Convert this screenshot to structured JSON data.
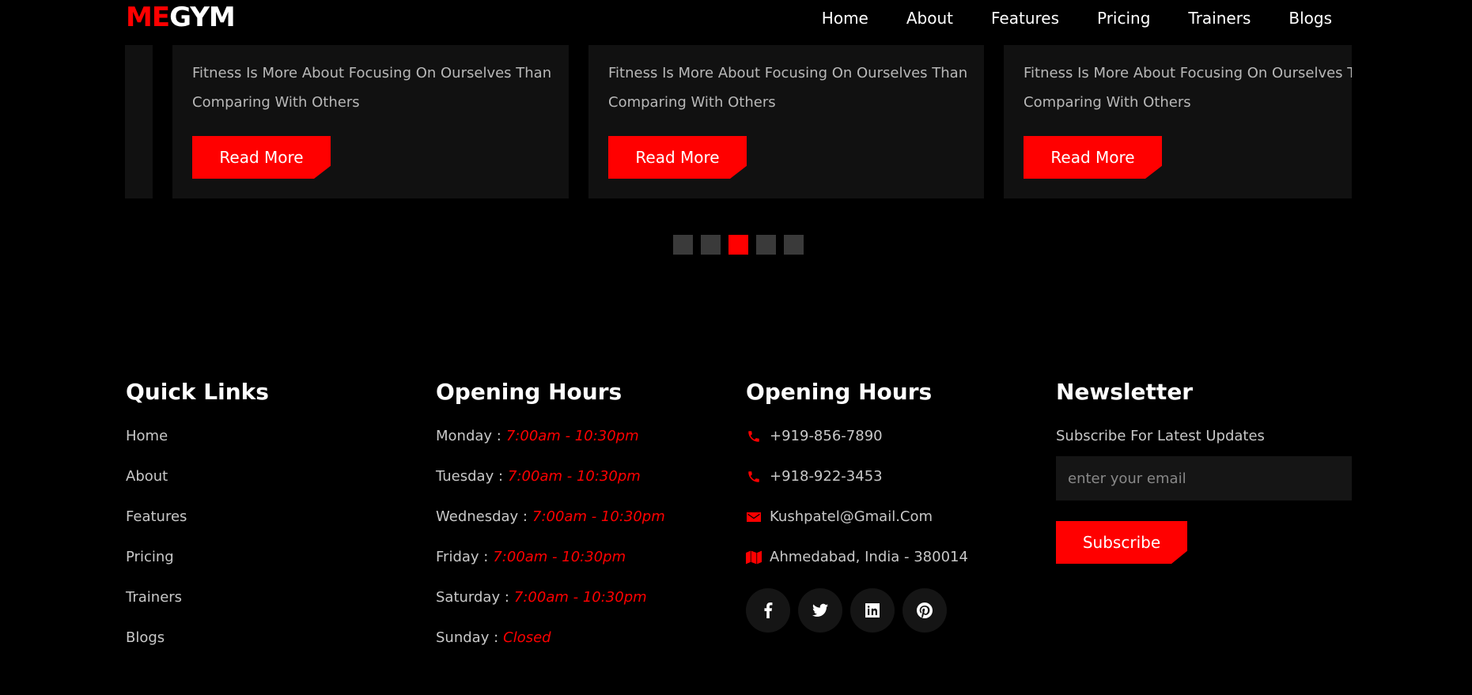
{
  "brand": {
    "part1": "ME",
    "part2": "GYM",
    "accent": "#ff0000"
  },
  "nav": [
    "Home",
    "About",
    "Features",
    "Pricing",
    "Trainers",
    "Blogs"
  ],
  "cards": [
    {
      "text": "Fitness Is More About Focusing On Ourselves Than Comparing With Others",
      "button": "Read More"
    },
    {
      "text": "Fitness Is More About Focusing On Ourselves Than Comparing With Others",
      "button": "Read More"
    },
    {
      "text": "Fitness Is More About Focusing On Ourselves Than Comparing With Others",
      "button": "Read More"
    }
  ],
  "carousel": {
    "total": 5,
    "active_index": 3
  },
  "quick_links": {
    "title": "Quick Links",
    "items": [
      "Home",
      "About",
      "Features",
      "Pricing",
      "Trainers",
      "Blogs"
    ]
  },
  "hours": {
    "title": "Opening Hours",
    "items": [
      {
        "day": "Monday :",
        "time": "7:00am - 10:30pm"
      },
      {
        "day": "Tuesday :",
        "time": "7:00am - 10:30pm"
      },
      {
        "day": "Wednesday :",
        "time": "7:00am - 10:30pm"
      },
      {
        "day": "Friday :",
        "time": "7:00am - 10:30pm"
      },
      {
        "day": "Saturday :",
        "time": "7:00am - 10:30pm"
      },
      {
        "day": "Sunday :",
        "time": "Closed"
      }
    ]
  },
  "contact": {
    "title": "Opening Hours",
    "phone1": "+919-856-7890",
    "phone2": "+918-922-3453",
    "email": "Kushpatel@Gmail.Com",
    "address": "Ahmedabad, India - 380014",
    "socials": [
      "facebook-icon",
      "twitter-icon",
      "linkedin-icon",
      "pinterest-icon"
    ]
  },
  "newsletter": {
    "title": "Newsletter",
    "subtitle": "Subscribe For Latest Updates",
    "placeholder": "enter your email",
    "button": "Subscribe"
  }
}
